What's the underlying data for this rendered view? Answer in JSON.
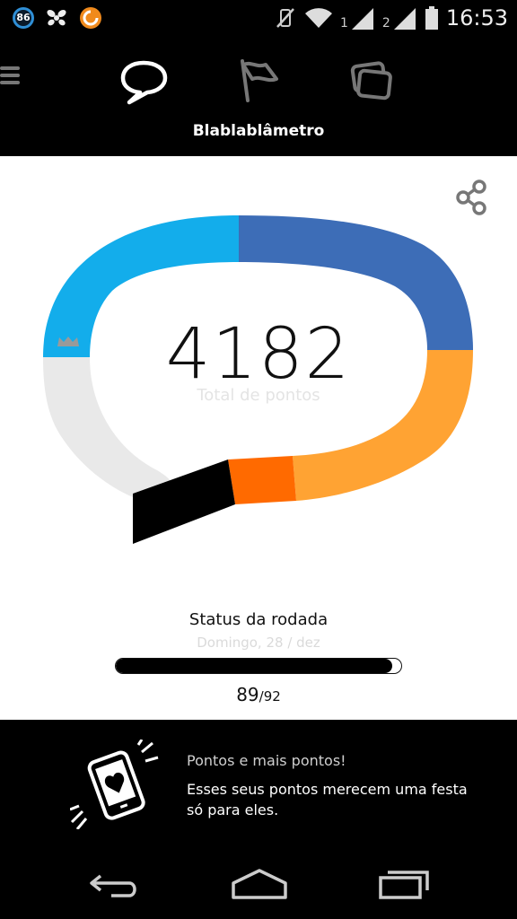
{
  "status_bar": {
    "notification_badge": "86",
    "sim1": "1",
    "sim2": "2",
    "time": "16:53"
  },
  "header": {
    "title": "Blablablâmetro",
    "tabs": [
      {
        "icon": "chat-bubble-icon",
        "active": true
      },
      {
        "icon": "flag-icon",
        "active": false
      },
      {
        "icon": "cards-icon",
        "active": false
      }
    ]
  },
  "score": {
    "value": "4182",
    "label": "Total de pontos"
  },
  "gauge": {
    "segments": [
      {
        "name": "black",
        "color": "#000000"
      },
      {
        "name": "dark-orange",
        "color": "#ff6a00"
      },
      {
        "name": "orange",
        "color": "#ffa333"
      },
      {
        "name": "dark-blue",
        "color": "#3d6db7"
      },
      {
        "name": "light-blue",
        "color": "#13adeb"
      },
      {
        "name": "empty",
        "color": "#e9e9e9"
      }
    ],
    "marker_icon": "crown-icon"
  },
  "round": {
    "title": "Status da rodada",
    "date": "Domingo, 28 / dez",
    "current": "89",
    "total": "/92",
    "progress_fraction": 0.967
  },
  "promo": {
    "icon": "phone-heart-icon",
    "title": "Pontos e mais pontos!",
    "text": "Esses seus pontos merecem uma festa só para eles."
  },
  "colors": {
    "background_dark": "#000000",
    "panel": "#ffffff",
    "inactive_icon": "#777777"
  }
}
